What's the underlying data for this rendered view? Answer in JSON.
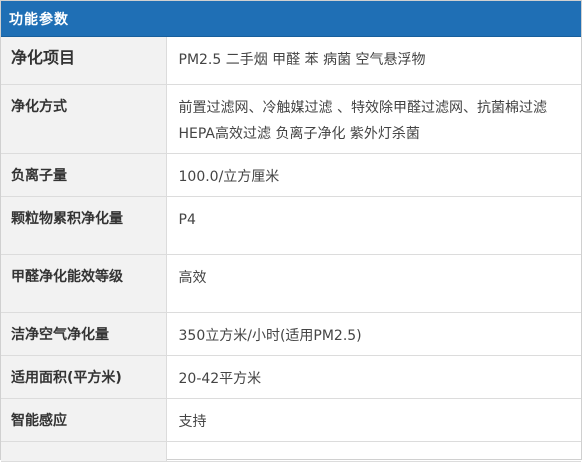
{
  "header": {
    "title": "功能参数"
  },
  "specs": [
    {
      "label": "净化项目",
      "value": "PM2.5 二手烟 甲醛 苯 病菌 空气悬浮物"
    },
    {
      "label": "净化方式",
      "value": "前置过滤网、冷触媒过滤 、特效除甲醛过滤网、抗菌棉过滤 HEPA高效过滤 负离子净化 紫外灯杀菌"
    },
    {
      "label": "负离子量",
      "value": "100.0/立方厘米"
    },
    {
      "label": "颗粒物累积净化量",
      "value": "P4"
    },
    {
      "label": "甲醛净化能效等级",
      "value": "高效"
    },
    {
      "label": "洁净空气净化量",
      "value": "350立方米/小时(适用PM2.5)"
    },
    {
      "label": "适用面积(平方米)",
      "value": "20-42平方米"
    },
    {
      "label": "智能感应",
      "value": "支持"
    }
  ]
}
